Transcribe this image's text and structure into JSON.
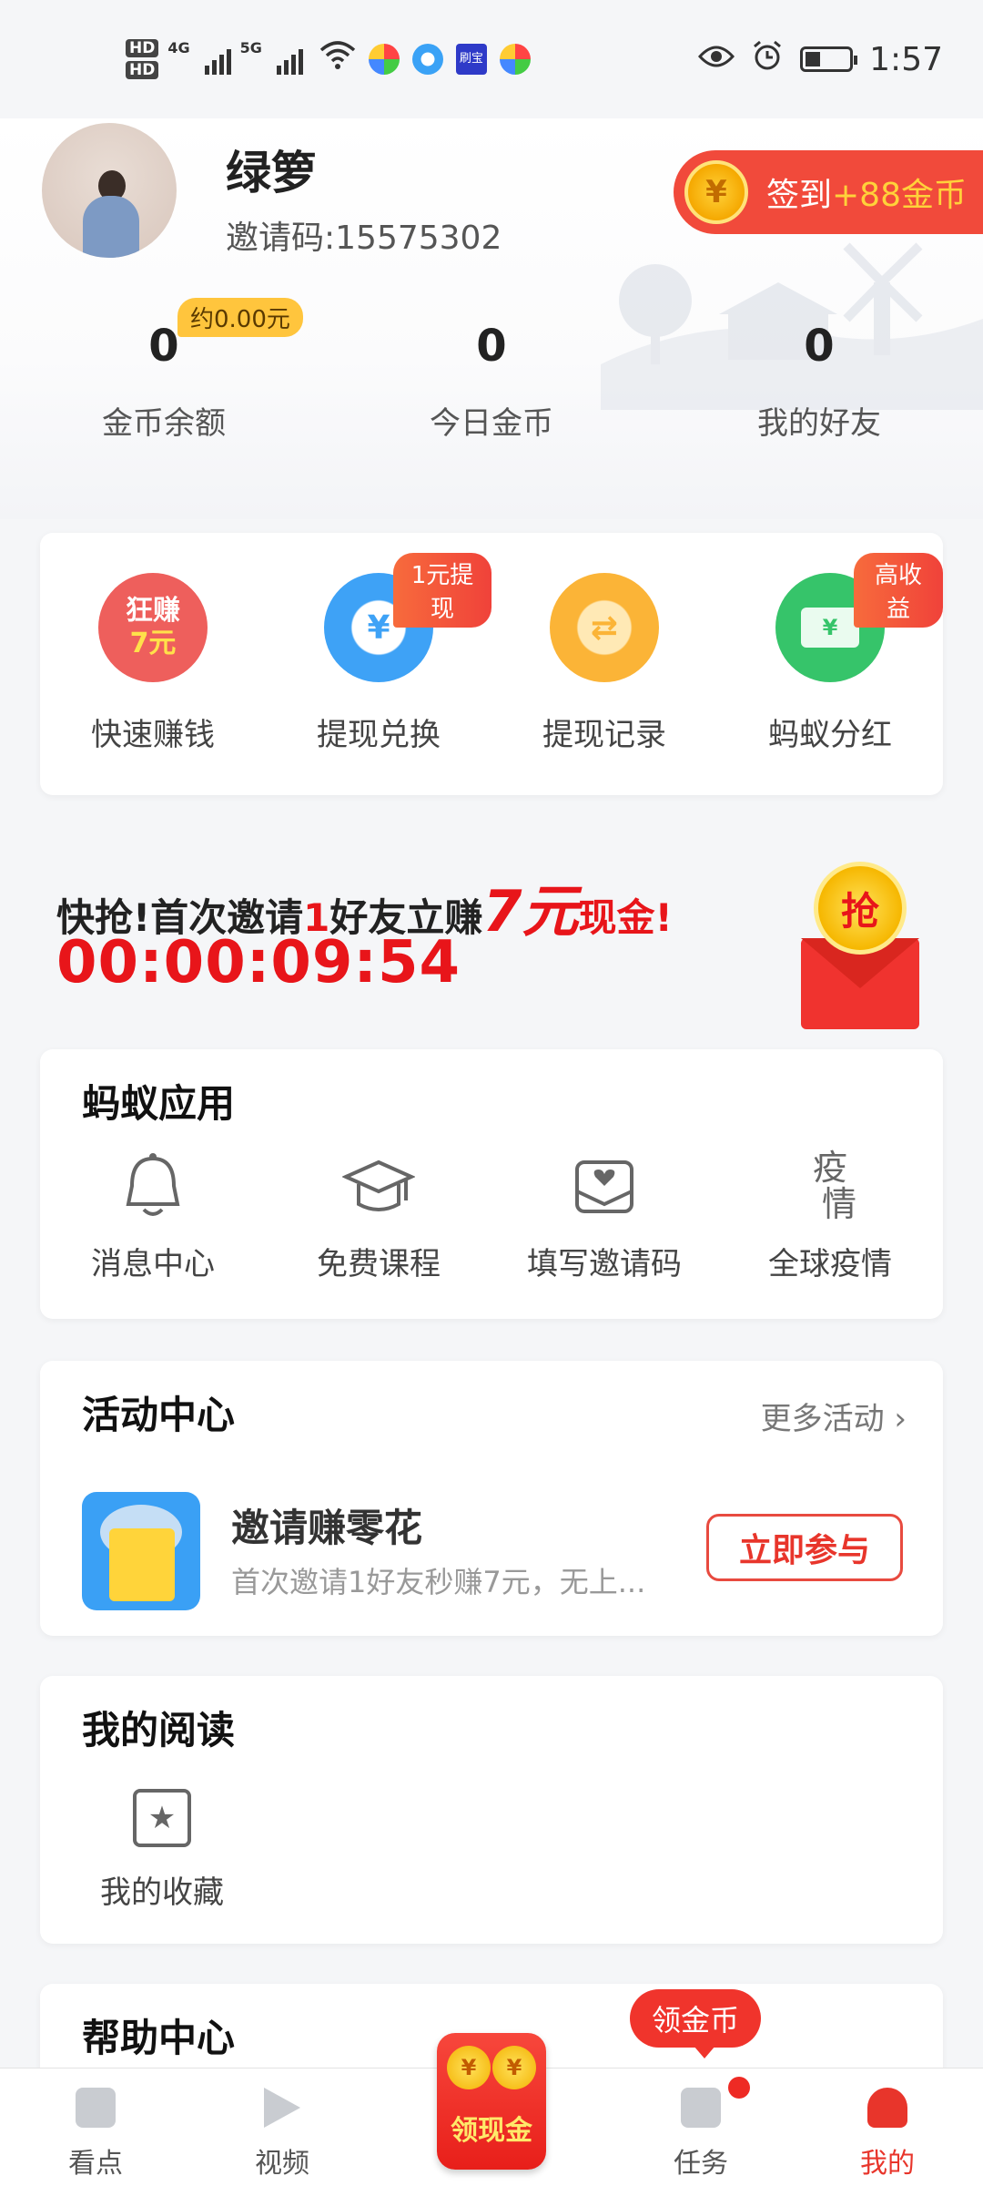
{
  "status_bar": {
    "hd1": "HD",
    "hd2": "HD",
    "net1": "4G",
    "net2": "5G",
    "time": "1:57",
    "app_icon_label": "刷宝"
  },
  "profile": {
    "name": "绿箩",
    "invite_code": "邀请码:15575302",
    "signin_label": "签到",
    "signin_bonus": "+88金币",
    "coin_symbol": "¥"
  },
  "stats": [
    {
      "value": "0",
      "label": "金币余额",
      "badge": "约0.00元"
    },
    {
      "value": "0",
      "label": "今日金币"
    },
    {
      "value": "0",
      "label": "我的好友"
    }
  ],
  "quick_actions": [
    {
      "label": "快速赚钱",
      "icon_text": "狂赚7元",
      "icon": "earn-icon",
      "color": "#ee5f5c"
    },
    {
      "label": "提现兑换",
      "icon_text": "¥",
      "icon": "yen-icon",
      "color": "#3ea2f6",
      "badge": "1元提现"
    },
    {
      "label": "提现记录",
      "icon_text": "⇄",
      "icon": "exchange-icon",
      "color": "#fbb437"
    },
    {
      "label": "蚂蚁分红",
      "icon_text": "¥",
      "icon": "card-icon",
      "color": "#36c46a",
      "badge": "高收益"
    }
  ],
  "promo": {
    "line_a": "快抢!首次邀请",
    "line_num": "1",
    "line_b": "好友立赚",
    "line_big": "7元",
    "line_c": "现金",
    "line_end": "!",
    "timer": "00:00:09:54",
    "grab_label": "抢"
  },
  "apps": {
    "title": "蚂蚁应用",
    "items": [
      {
        "label": "消息中心",
        "icon": "bell-icon",
        "glyph": "🔔"
      },
      {
        "label": "免费课程",
        "icon": "graduation-cap-icon",
        "glyph": "🎓"
      },
      {
        "label": "填写邀请码",
        "icon": "mail-heart-icon",
        "glyph": "✉"
      },
      {
        "label": "全球疫情",
        "icon": "virus-icon",
        "glyph": "疫情"
      }
    ]
  },
  "activity": {
    "title": "活动中心",
    "more": "更多活动 ›",
    "item_title": "邀请赚零花",
    "item_desc": "首次邀请1好友秒赚7元，无上...",
    "join": "立即参与"
  },
  "reading": {
    "title": "我的阅读",
    "favorite": "我的收藏"
  },
  "help": {
    "title": "帮助中心"
  },
  "bottom_nav": {
    "items": [
      {
        "label": "看点",
        "icon": "news-icon"
      },
      {
        "label": "视频",
        "icon": "play-icon"
      },
      {
        "label": "任务",
        "icon": "task-icon"
      },
      {
        "label": "我的",
        "icon": "profile-icon"
      }
    ],
    "center_label": "领现金",
    "bubble": "领金币",
    "active_color": "#e8352b"
  }
}
